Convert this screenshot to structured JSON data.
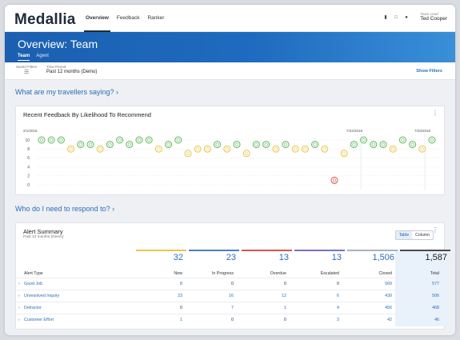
{
  "topbar": {
    "logo": "Medallia",
    "tabs": [
      {
        "label": "Overview",
        "active": true
      },
      {
        "label": "Feedback",
        "active": false
      },
      {
        "label": "Ranker",
        "active": false
      }
    ],
    "user_role": "Team Lead",
    "user_name": "Ted Cooper"
  },
  "hero": {
    "title": "Overview: Team",
    "tabs": [
      {
        "label": "Team",
        "active": true
      },
      {
        "label": "Agent",
        "active": false
      }
    ]
  },
  "filters": {
    "saved_label": "Saved Filters",
    "period_label": "Time Period",
    "period_value": "Past 12 months (Demo)",
    "show_filters": "Show Filters"
  },
  "section1": "What are my travellers saying? ›",
  "feedback_card": {
    "title": "Recent Feedback By Likelihood To Recommend",
    "dates": [
      "2/1/2018",
      "7/22/2018",
      "7/23/2018"
    ],
    "y_ticks": [
      "10",
      "8",
      "6",
      "4",
      "2",
      "0"
    ]
  },
  "section2": "Who do I need to respond to? ›",
  "alert": {
    "title": "Alert Summary",
    "subtitle": "Past 12 months (Demo)",
    "toggle_table": "Table",
    "toggle_column": "Column",
    "stats": [
      {
        "value": "32",
        "color": "#e8c54a"
      },
      {
        "value": "23",
        "color": "#4a7fc8"
      },
      {
        "value": "13",
        "color": "#d9534f"
      },
      {
        "value": "13",
        "color": "#7b6fc4"
      },
      {
        "value": "1,506",
        "color": "#a6b2bf"
      },
      {
        "value": "1,587",
        "color": "#4a4a4a"
      }
    ],
    "headers": [
      "Alert Type",
      "New",
      "In Progress",
      "Overdue",
      "Escalated",
      "Closed",
      "Total"
    ],
    "rows": [
      {
        "name": "Good Job",
        "vals": [
          "8",
          "0",
          "0",
          "0",
          "569",
          "577"
        ]
      },
      {
        "name": "Unresolved Inquiry",
        "vals": [
          "23",
          "16",
          "12",
          "6",
          "439",
          "506"
        ]
      },
      {
        "name": "Detractor",
        "vals": [
          "0",
          "7",
          "1",
          "4",
          "456",
          "468"
        ]
      },
      {
        "name": "Customer Effort",
        "vals": [
          "1",
          "0",
          "0",
          "3",
          "42",
          "46"
        ]
      }
    ]
  },
  "chart_data": {
    "type": "scatter",
    "title": "Recent Feedback By Likelihood To Recommend",
    "ylim": [
      0,
      10
    ],
    "y_ticks": [
      0,
      2,
      4,
      6,
      8,
      10
    ],
    "x_labels": [
      "2/1/2018",
      "7/22/2018",
      "7/23/2018"
    ],
    "points": [
      {
        "y": 10,
        "c": "g"
      },
      {
        "y": 10,
        "c": "g"
      },
      {
        "y": 10,
        "c": "g"
      },
      {
        "y": 8,
        "c": "y"
      },
      {
        "y": 9,
        "c": "g"
      },
      {
        "y": 9,
        "c": "g"
      },
      {
        "y": 8,
        "c": "y"
      },
      {
        "y": 9,
        "c": "g"
      },
      {
        "y": 10,
        "c": "g"
      },
      {
        "y": 9,
        "c": "g"
      },
      {
        "y": 10,
        "c": "g"
      },
      {
        "y": 10,
        "c": "g"
      },
      {
        "y": 8,
        "c": "y"
      },
      {
        "y": 9,
        "c": "g"
      },
      {
        "y": 10,
        "c": "g"
      },
      {
        "y": 7,
        "c": "y"
      },
      {
        "y": 8,
        "c": "y"
      },
      {
        "y": 8,
        "c": "y"
      },
      {
        "y": 9,
        "c": "g"
      },
      {
        "y": 8,
        "c": "y"
      },
      {
        "y": 9,
        "c": "g"
      },
      {
        "y": 7,
        "c": "y"
      },
      {
        "y": 9,
        "c": "g"
      },
      {
        "y": 9,
        "c": "g"
      },
      {
        "y": 8,
        "c": "y"
      },
      {
        "y": 9,
        "c": "g"
      },
      {
        "y": 8,
        "c": "y"
      },
      {
        "y": 8,
        "c": "y"
      },
      {
        "y": 9,
        "c": "g"
      },
      {
        "y": 8,
        "c": "y"
      },
      {
        "y": 1,
        "c": "r"
      },
      {
        "y": 7,
        "c": "y"
      },
      {
        "y": 9,
        "c": "g"
      },
      {
        "y": 10,
        "c": "g"
      },
      {
        "y": 9,
        "c": "g"
      },
      {
        "y": 9,
        "c": "g"
      },
      {
        "y": 8,
        "c": "y"
      },
      {
        "y": 10,
        "c": "g"
      },
      {
        "y": 9,
        "c": "g"
      },
      {
        "y": 8,
        "c": "y"
      },
      {
        "y": 10,
        "c": "g"
      }
    ],
    "colors": {
      "g": "#5cb85c",
      "y": "#e8c54a",
      "r": "#d9534f"
    }
  }
}
